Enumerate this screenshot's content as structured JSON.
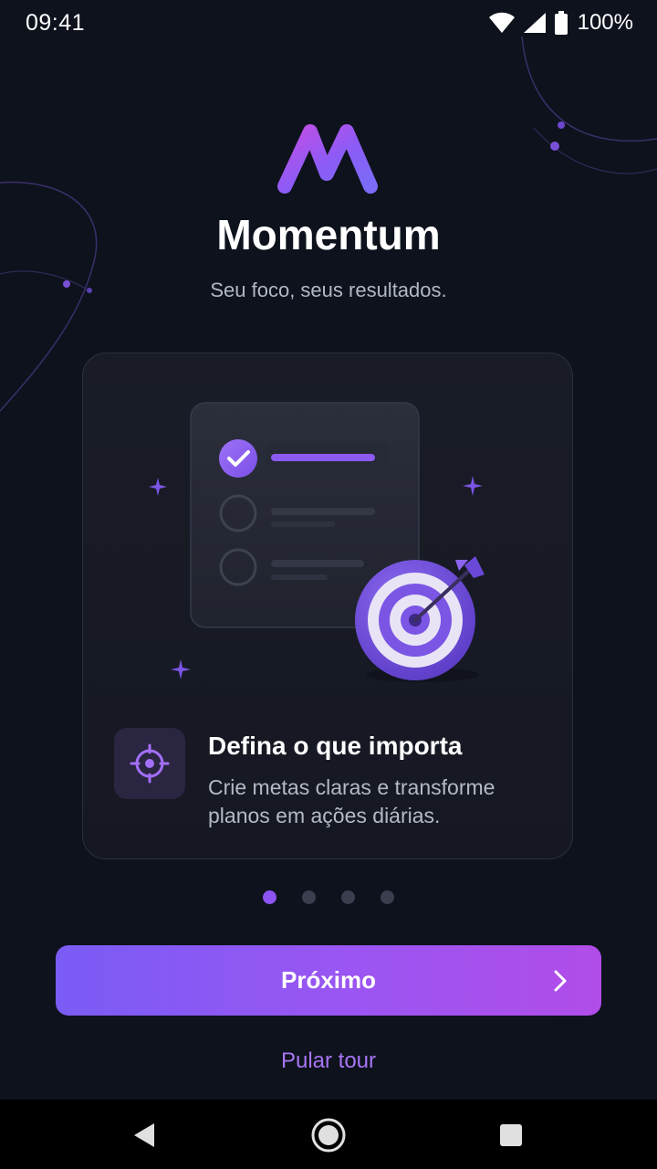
{
  "status_bar": {
    "time": "09:41",
    "battery_percent": "100%",
    "icons": [
      "wifi-icon",
      "cellular-signal-icon",
      "battery-icon"
    ]
  },
  "header": {
    "logo_icon": "momentum-logo",
    "app_name": "Momentum",
    "tagline": "Seu foco, seus resultados."
  },
  "card": {
    "illustration": {
      "checklist_items": [
        {
          "checked": true
        },
        {
          "checked": false
        },
        {
          "checked": false
        }
      ],
      "target_icon": "target-with-arrow-icon",
      "sparkle_icon": "sparkle-icon"
    },
    "feature_icon": "crosshair-icon",
    "feature_title": "Defina o que importa",
    "feature_description": "Crie metas claras e transforme planos em ações diárias."
  },
  "pagination": {
    "total": 4,
    "current": 1
  },
  "actions": {
    "next_label": "Próximo",
    "next_icon": "chevron-right-icon",
    "skip_label": "Pular tour"
  },
  "nav_bar": {
    "buttons": [
      "back-icon",
      "home-icon",
      "recents-icon"
    ]
  },
  "colors": {
    "background": "#0e121d",
    "card": "#171a24",
    "accent": "#8c54f2",
    "accent_gradient_start": "#7a5cf5",
    "accent_gradient_end": "#b14de8",
    "link": "#a775f4",
    "text_secondary": "#b2b8c6"
  }
}
